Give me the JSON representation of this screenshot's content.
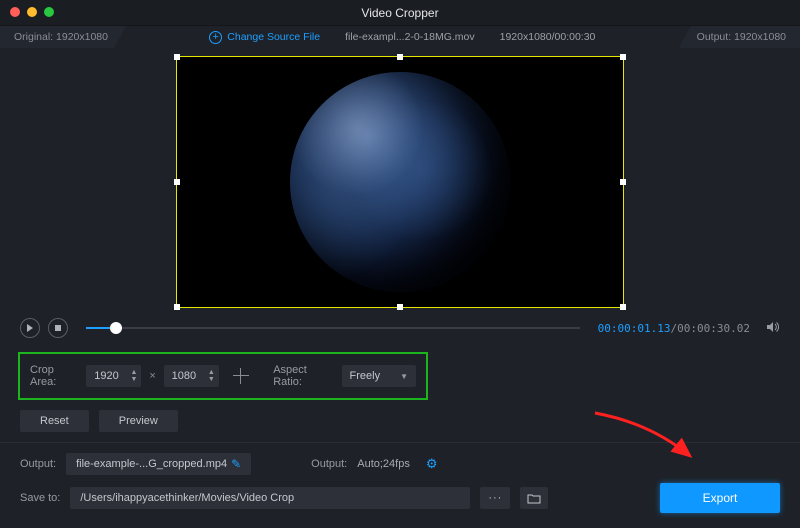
{
  "title": "Video Cropper",
  "info": {
    "original_label": "Original: 1920x1080",
    "change_source": "Change Source File",
    "file_name": "file-exampl...2-0-18MG.mov",
    "src_dims": "1920x1080/00:00:30",
    "output_label": "Output: 1920x1080"
  },
  "transport": {
    "current_time": "00:00:01.13",
    "total_time": "/00:00:30.02"
  },
  "crop": {
    "area_label": "Crop Area:",
    "w": "1920",
    "h": "1080",
    "ratio_label": "Aspect Ratio:",
    "ratio_value": "Freely"
  },
  "buttons": {
    "reset": "Reset",
    "preview": "Preview",
    "export": "Export"
  },
  "output": {
    "label1": "Output:",
    "filename": "file-example-...G_cropped.mp4",
    "label2": "Output:",
    "format": "Auto;24fps"
  },
  "save": {
    "label": "Save to:",
    "path": "/Users/ihappyacethinker/Movies/Video Crop",
    "more": "···"
  }
}
